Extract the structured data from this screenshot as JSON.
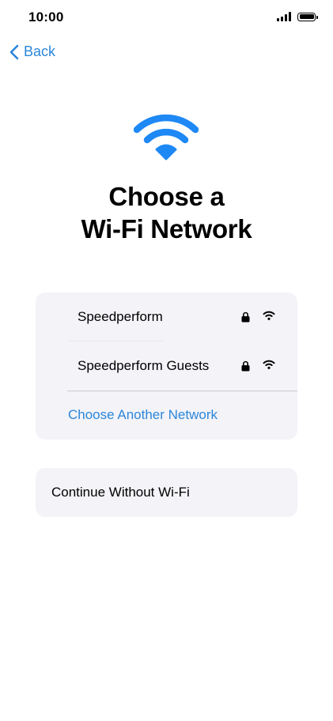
{
  "status_bar": {
    "time": "10:00",
    "icons": [
      "cellular-signal-icon",
      "battery-icon"
    ]
  },
  "nav": {
    "back_label": "Back",
    "back_icon": "chevron-left-icon"
  },
  "header": {
    "icon": "wifi-icon",
    "title_line1": "Choose a",
    "title_line2": "Wi-Fi Network"
  },
  "networks": [
    {
      "name": "Speedperform",
      "secured": true,
      "icons": [
        "lock-icon",
        "wifi-signal-icon"
      ]
    },
    {
      "name": "Speedperform Guests",
      "secured": true,
      "icons": [
        "lock-icon",
        "wifi-signal-icon"
      ]
    }
  ],
  "choose_another_label": "Choose Another Network",
  "continue_without_label": "Continue Without Wi-Fi",
  "colors": {
    "accent": "#2c86d9",
    "wifi_hero": "#1e88f5",
    "card_background": "#f3f3f8",
    "text": "#000000"
  }
}
